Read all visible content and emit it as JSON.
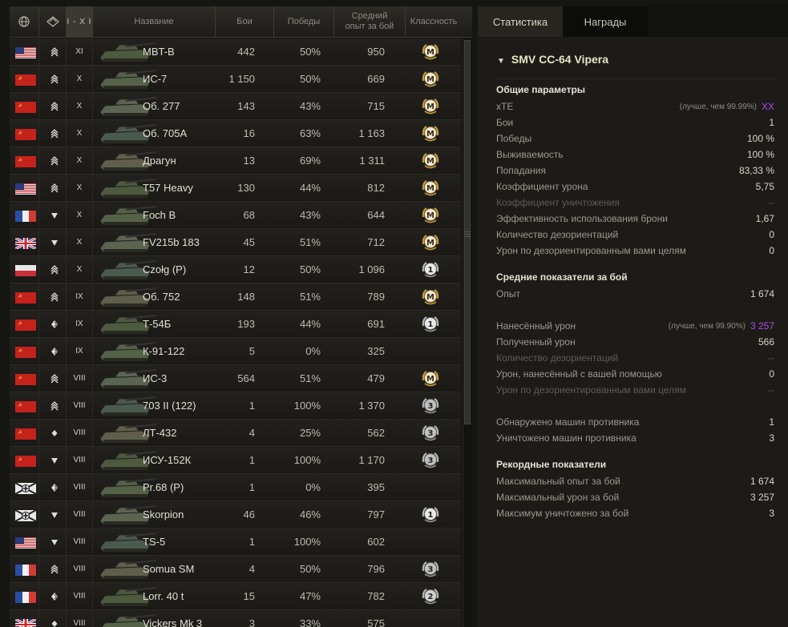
{
  "table": {
    "headers": {
      "tier_filter": "I - X I",
      "name": "Название",
      "battles": "Бои",
      "wins": "Победы",
      "avg_xp": "Средний опыт за бой",
      "mastery": "Классность"
    },
    "rows": [
      {
        "nation": "usa",
        "type": "heavy",
        "tier": "XI",
        "name": "MBT-B",
        "battles": "442",
        "wins": "50%",
        "xp": "950",
        "mastery": "M"
      },
      {
        "nation": "ussr",
        "type": "heavy",
        "tier": "X",
        "name": "ИС-7",
        "battles": "1 150",
        "wins": "50%",
        "xp": "669",
        "mastery": "M"
      },
      {
        "nation": "ussr",
        "type": "heavy",
        "tier": "X",
        "name": "Об. 277",
        "battles": "143",
        "wins": "43%",
        "xp": "715",
        "mastery": "M"
      },
      {
        "nation": "ussr",
        "type": "heavy",
        "tier": "X",
        "name": "Об. 705А",
        "battles": "16",
        "wins": "63%",
        "xp": "1 163",
        "mastery": "M"
      },
      {
        "nation": "ussr",
        "type": "heavy",
        "tier": "X",
        "name": "Драгун",
        "battles": "13",
        "wins": "69%",
        "xp": "1 311",
        "mastery": "M"
      },
      {
        "nation": "usa",
        "type": "heavy",
        "tier": "X",
        "name": "T57 Heavy",
        "battles": "130",
        "wins": "44%",
        "xp": "812",
        "mastery": "M"
      },
      {
        "nation": "france",
        "type": "td",
        "tier": "X",
        "name": "Foch B",
        "battles": "68",
        "wins": "43%",
        "xp": "644",
        "mastery": "M"
      },
      {
        "nation": "uk",
        "type": "td",
        "tier": "X",
        "name": "FV215b 183",
        "battles": "45",
        "wins": "51%",
        "xp": "712",
        "mastery": "M"
      },
      {
        "nation": "poland",
        "type": "heavy",
        "tier": "X",
        "name": "Czołg (P)",
        "battles": "12",
        "wins": "50%",
        "xp": "1 096",
        "mastery": "1"
      },
      {
        "nation": "ussr",
        "type": "heavy",
        "tier": "IX",
        "name": "Об. 752",
        "battles": "148",
        "wins": "51%",
        "xp": "789",
        "mastery": "M"
      },
      {
        "nation": "ussr",
        "type": "medium",
        "tier": "IX",
        "name": "Т-54Б",
        "battles": "193",
        "wins": "44%",
        "xp": "691",
        "mastery": "1"
      },
      {
        "nation": "ussr",
        "type": "medium",
        "tier": "IX",
        "name": "К-91-122",
        "battles": "5",
        "wins": "0%",
        "xp": "325",
        "mastery": ""
      },
      {
        "nation": "ussr",
        "type": "heavy",
        "tier": "VIII",
        "name": "ИС-3",
        "battles": "564",
        "wins": "51%",
        "xp": "479",
        "mastery": "M"
      },
      {
        "nation": "ussr",
        "type": "heavy",
        "tier": "VIII",
        "name": "703 II (122)",
        "battles": "1",
        "wins": "100%",
        "xp": "1 370",
        "mastery": "3"
      },
      {
        "nation": "ussr",
        "type": "light",
        "tier": "VIII",
        "name": "ЛТ-432",
        "battles": "4",
        "wins": "25%",
        "xp": "562",
        "mastery": "3"
      },
      {
        "nation": "ussr",
        "type": "td",
        "tier": "VIII",
        "name": "ИСУ-152К",
        "battles": "1",
        "wins": "100%",
        "xp": "1 170",
        "mastery": "3"
      },
      {
        "nation": "germany",
        "type": "medium",
        "tier": "VIII",
        "name": "Pr.68 (P)",
        "battles": "1",
        "wins": "0%",
        "xp": "395",
        "mastery": ""
      },
      {
        "nation": "germany",
        "type": "td",
        "tier": "VIII",
        "name": "Skorpion",
        "battles": "46",
        "wins": "46%",
        "xp": "797",
        "mastery": "1"
      },
      {
        "nation": "usa",
        "type": "td",
        "tier": "VIII",
        "name": "TS-5",
        "battles": "1",
        "wins": "100%",
        "xp": "602",
        "mastery": ""
      },
      {
        "nation": "france",
        "type": "heavy",
        "tier": "VIII",
        "name": "Somua SM",
        "battles": "4",
        "wins": "50%",
        "xp": "796",
        "mastery": "3"
      },
      {
        "nation": "france",
        "type": "medium",
        "tier": "VIII",
        "name": "Lorr. 40 t",
        "battles": "15",
        "wins": "47%",
        "xp": "782",
        "mastery": "2"
      },
      {
        "nation": "uk",
        "type": "light",
        "tier": "VIII",
        "name": "Vickers Mk 3",
        "battles": "3",
        "wins": "33%",
        "xp": "575",
        "mastery": ""
      }
    ]
  },
  "tabs": {
    "stats": "Статистика",
    "awards": "Награды"
  },
  "vehicle_title": "SMV CC-64 Vipera",
  "sections": {
    "general": "Общие параметры",
    "average": "Средние показатели за бой",
    "records": "Рекордные показатели"
  },
  "general_stats": [
    {
      "label": "xTE",
      "note": "(лучше, чем 99.99%)",
      "value": "XX",
      "highlight": true
    },
    {
      "label": "Бои",
      "value": "1"
    },
    {
      "label": "Победы",
      "value": "100 %"
    },
    {
      "label": "Выживаемость",
      "value": "100 %"
    },
    {
      "label": "Попадания",
      "value": "83,33 %"
    },
    {
      "label": "Коэффициент урона",
      "value": "5,75"
    },
    {
      "label": "Коэффициент уничтожения",
      "value": "--",
      "dim": true
    },
    {
      "label": "Эффективность использования брони",
      "value": "1,67"
    },
    {
      "label": "Количество дезориентаций",
      "value": "0"
    },
    {
      "label": "Урон по дезориентированным вами целям",
      "value": "0"
    }
  ],
  "average_stats": [
    {
      "label": "Опыт",
      "value": "1 674"
    },
    {
      "label": "Нанесённый урон",
      "note": "(лучше, чем 99.90%)",
      "value": "3 257",
      "highlight": true
    },
    {
      "label": "Полученный урон",
      "value": "566"
    },
    {
      "label": "Количество дезориентаций",
      "value": "--",
      "dim": true
    },
    {
      "label": "Урон, нанесённый с вашей помощью",
      "value": "0"
    },
    {
      "label": "Урон по дезориентированным вами целям",
      "value": "--",
      "dim": true
    },
    {
      "label": "Обнаружено машин противника",
      "value": "1"
    },
    {
      "label": "Уничтожено машин противника",
      "value": "3"
    }
  ],
  "record_stats": [
    {
      "label": "Максимальный опыт за бой",
      "value": "1 674"
    },
    {
      "label": "Максимальный урон за бой",
      "value": "3 257"
    },
    {
      "label": "Максимум уничтожено за бой",
      "value": "3"
    }
  ],
  "colors": {
    "highlight": "#b04ce8",
    "background": "#151512"
  }
}
